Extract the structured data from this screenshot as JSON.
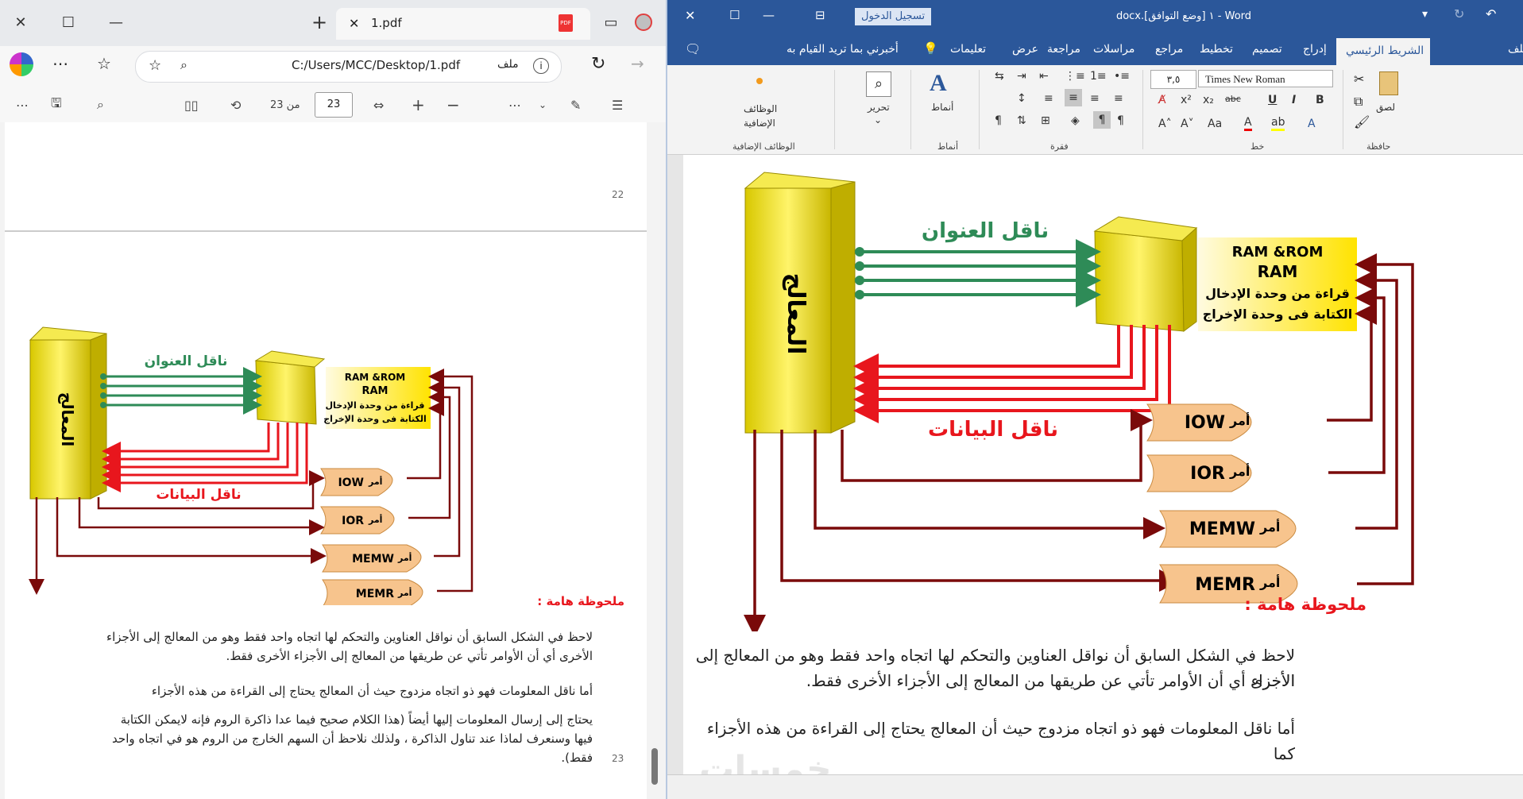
{
  "pdf_window": {
    "tab_title": "1.pdf",
    "address": "C:/Users/MCC/Desktop/1.pdf",
    "file_label": "ملف",
    "page_input": "23",
    "page_of": "من 23",
    "prev_page_number": "22",
    "page_number": "23",
    "diagram": {
      "address_bus": "ناقل العنوان",
      "data_bus": "ناقل البيانات",
      "processor": "المعالج",
      "mem_line1": "RAM &ROM",
      "mem_line2": "RAM",
      "mem_line3": "قراءة من وحدة الإدخال",
      "mem_line4": "الكتابة فى وحدة الإخراج",
      "iow": "IOW",
      "ior": "IOR",
      "memw": "MEMW",
      "memr": "MEMR",
      "cmd": "أمر",
      "note": "ملحوظة هامة :"
    },
    "paragraphs": [
      "لاحظ في الشكل السابق أن نواقل العناوين والتحكم لها اتجاه واحد فقط وهو من المعالج إلى الأجزاء",
      "الأخرى أي أن الأوامر تأتي عن طريقها من المعالج إلى الأجزاء الأخرى فقط.",
      "أما ناقل المعلومات فهو ذو اتجاه مزدوج حيث أن المعالج يحتاج إلى القراءة من هذه الأجزاء",
      "يحتاج إلى إرسال المعلومات إليها أيضاً (هذا الكلام صحيح فيما عدا ذاكرة الروم فإنه لايمكن الكتابة",
      "فيها وسنعرف لماذا عند تناول الذاكرة ، ولذلك نلاحظ أن السهم الخارج من الروم هو في اتجاه واحد",
      "فقط)."
    ]
  },
  "word_window": {
    "title": "docx.١ [وضع التوافق] - Word",
    "signin": "تسجيل الدخول",
    "tabs": [
      "ملف",
      "الشريط الرئيسي",
      "إدراج",
      "تصميم",
      "تخطيط",
      "مراجع",
      "مراسلات",
      "مراجعة",
      "عرض",
      "تعليمات"
    ],
    "tell_me": "أخبرني بما تريد القيام به",
    "font_name": "Times New Roman",
    "font_size": "٣,٥",
    "groups": {
      "font": "خط",
      "paragraph": "فقرة",
      "styles": "أنماط",
      "addins": "الوظائف الإضافية",
      "clipboard": "حافظة"
    },
    "styles_label": "أنماط",
    "editing_label": "تحرير",
    "addins_label1": "الوظائف",
    "addins_label2": "الإضافية",
    "paste_label": "لصق",
    "paragraphs": [
      "لاحظ في الشكل السابق أن نواقل العناوين والتحكم لها اتجاه واحد فقط وهو من المعالج إلى الأجزاء",
      "الأخرى أي أن الأوامر تأتي عن طريقها من المعالج إلى الأجزاء الأخرى فقط.",
      "أما ناقل المعلومات فهو ذو اتجاه مزدوج حيث أن المعالج يحتاج إلى القراءة من هذه الأجزاء      كما"
    ],
    "watermark": "خمسات"
  },
  "colors": {
    "word_blue": "#2b579a",
    "bus_green": "#2e8b57",
    "bus_red": "#e8161d",
    "control_dark": "#7a0a0a",
    "yellow": "#e6d800",
    "orange": "#f7c48d"
  }
}
